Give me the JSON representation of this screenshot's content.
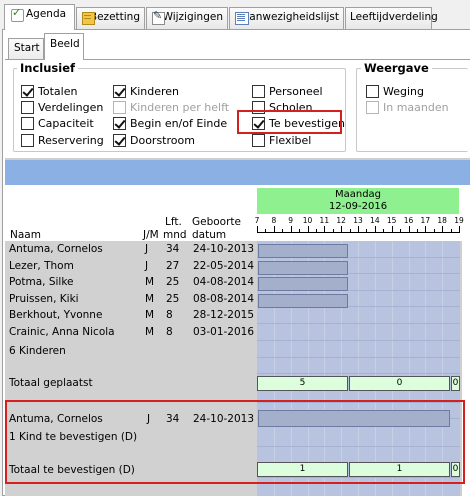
{
  "top_tabs": [
    {
      "label": "Agenda",
      "icon": "agenda-icon",
      "active": true
    },
    {
      "label": "Bezetting",
      "icon": "bezetting-icon"
    },
    {
      "label": "Wijzigingen",
      "icon": "wijzigingen-icon"
    },
    {
      "label": "Aanwezigheidslijst",
      "icon": "aanwezigheidslijst-icon"
    },
    {
      "label": "Leeftijdverdeling"
    }
  ],
  "sub_tabs": [
    {
      "label": "Start"
    },
    {
      "label": "Beeld",
      "active": true
    }
  ],
  "inclusief": {
    "title": "Inclusief",
    "options": [
      {
        "label": "Totalen",
        "checked": true,
        "disabled": false
      },
      {
        "label": "Verdelingen",
        "checked": false,
        "disabled": false
      },
      {
        "label": "Capaciteit",
        "checked": false,
        "disabled": false
      },
      {
        "label": "Reservering",
        "checked": false,
        "disabled": false
      },
      {
        "label": "Kinderen",
        "checked": true,
        "disabled": false
      },
      {
        "label": "Kinderen per helft",
        "checked": false,
        "disabled": true
      },
      {
        "label": "Begin en/of Einde",
        "checked": true,
        "disabled": false
      },
      {
        "label": "Doorstroom",
        "checked": true,
        "disabled": false
      },
      {
        "label": "Personeel",
        "checked": false,
        "disabled": false
      },
      {
        "label": "Scholen",
        "checked": false,
        "disabled": false
      },
      {
        "label": "Te bevestigen",
        "checked": true,
        "disabled": false
      },
      {
        "label": "Flexibel",
        "checked": false,
        "disabled": false
      }
    ]
  },
  "weergave": {
    "title": "Weergave",
    "options": [
      {
        "label": "Weging",
        "checked": false,
        "disabled": false
      },
      {
        "label": "In maanden",
        "checked": false,
        "disabled": true
      }
    ]
  },
  "schedule": {
    "day_name": "Maandag",
    "day_date": "12-09-2016",
    "hours": [
      "7",
      "8",
      "9",
      "10",
      "11",
      "12",
      "13",
      "14",
      "15",
      "16",
      "17",
      "18",
      "19"
    ],
    "columns": {
      "naam": "Naam",
      "jm": "J/M",
      "lft": "Lft.",
      "mnd": "mnd",
      "geboorte": "Geboorte",
      "datum": "datum"
    },
    "children": [
      {
        "name": "Antuma, Cornelos",
        "jm": "J",
        "lft": "34",
        "dob": "24-10-2013"
      },
      {
        "name": "Lezer, Thom",
        "jm": "J",
        "lft": "27",
        "dob": "22-05-2014"
      },
      {
        "name": "Potma, Silke",
        "jm": "M",
        "lft": "25",
        "dob": "04-08-2014"
      },
      {
        "name": "Pruissen, Kiki",
        "jm": "M",
        "lft": "25",
        "dob": "08-08-2014"
      },
      {
        "name": "Berkhout, Yvonne",
        "jm": "M",
        "lft": "8",
        "dob": "28-12-2015"
      },
      {
        "name": "Crainic, Anna Nicola",
        "jm": "M",
        "lft": "8",
        "dob": "03-01-2016"
      }
    ],
    "children_count_label": "6 Kinderen",
    "totaal_geplaatst": {
      "label": "Totaal geplaatst",
      "values": [
        "5",
        "0",
        "0"
      ]
    },
    "te_bevestigen_child": {
      "name": "Antuma, Cornelos",
      "jm": "J",
      "lft": "34",
      "dob": "24-10-2013"
    },
    "te_bevestigen_count_label": "1 Kind te bevestigen (D)",
    "totaal_te_bevestigen": {
      "label": "Totaal te bevestigen (D)",
      "values": [
        "1",
        "1",
        "0"
      ]
    }
  }
}
